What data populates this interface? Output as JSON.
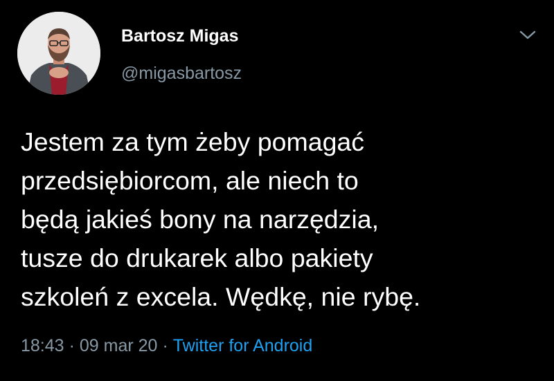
{
  "author": {
    "name": "Bartosz Migas",
    "handle": "@migasbartosz",
    "avatar_icon": "profile-photo"
  },
  "tweet": {
    "text_lines": [
      "Jestem za tym żeby pomagać",
      "przedsiębiorcom, ale niech to",
      "będą jakieś bony na narzędzia,",
      "tusze do drukarek albo pakiety",
      "szkoleń z excela. Wędkę, nie rybę."
    ]
  },
  "meta": {
    "time": "18:43",
    "separator": "·",
    "date": "09 mar 20",
    "source": "Twitter for Android"
  },
  "icons": {
    "menu": "chevron-down-icon"
  },
  "colors": {
    "background": "#000000",
    "text": "#ffffff",
    "muted": "#8899a6",
    "link": "#1da1f2"
  }
}
